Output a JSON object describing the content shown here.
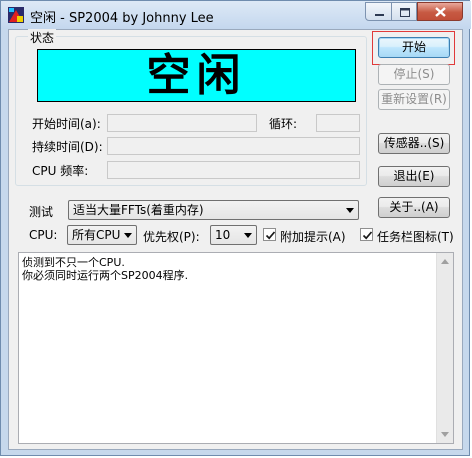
{
  "window": {
    "title": "空闲 - SP2004 by Johnny Lee"
  },
  "status_group": {
    "label": "状态",
    "status_text": "空闲",
    "status_bg": "#00ffff",
    "start_time_label": "开始时间(a):",
    "start_time_value": "",
    "loop_label": "循环:",
    "loop_value": "",
    "duration_label": "持续时间(D):",
    "duration_value": "",
    "cpu_freq_label": "CPU 频率:",
    "cpu_freq_value": ""
  },
  "buttons": {
    "start": "开始",
    "stop": "停止(S)",
    "reset": "重新设置(R)",
    "sensor": "传感器..(S)",
    "exit": "退出(E)",
    "about": "关于..(A)"
  },
  "test": {
    "label": "测试",
    "selected": "适当大量FFTs(着重内存)"
  },
  "cpu": {
    "label": "CPU:",
    "selected": "所有CPU"
  },
  "priority": {
    "label": "优先权(P):",
    "selected": "10"
  },
  "checkboxes": {
    "extra_hint": {
      "label": "附加提示(A)",
      "checked": true
    },
    "taskbar_icon": {
      "label": "任务栏图标(T)",
      "checked": true
    }
  },
  "log": {
    "lines": [
      "侦测到不只一个CPU.",
      "你必须同时运行两个SP2004程序."
    ]
  },
  "colors": {
    "highlight_border": "#e03a3a",
    "close_button": "#c75a43"
  },
  "icons": {
    "app": "sp2004-app-icon",
    "minimize": "minimize-icon",
    "maximize": "maximize-icon",
    "close": "close-icon"
  }
}
